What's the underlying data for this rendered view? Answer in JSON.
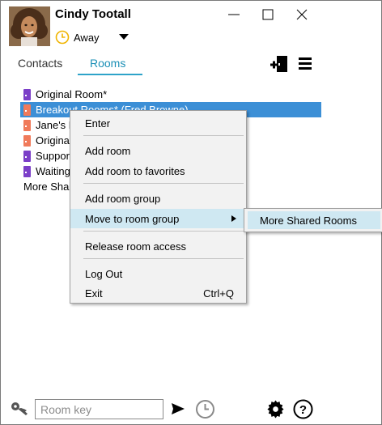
{
  "user": {
    "name": "Cindy Tootall",
    "status": "Away"
  },
  "tabs": [
    {
      "label": "Contacts",
      "active": false
    },
    {
      "label": "Rooms",
      "active": true
    }
  ],
  "rooms": [
    {
      "label": "Original Room*",
      "color": "#7b3fc8"
    },
    {
      "label": "Breakout Rooms* (Fred Browne)",
      "color": "#f07a5a",
      "selected": true
    },
    {
      "label": "Jane's M",
      "color": "#f07a5a"
    },
    {
      "label": "Origina",
      "color": "#f07a5a"
    },
    {
      "label": "Suppor",
      "color": "#7b3fc8"
    },
    {
      "label": "Waiting",
      "color": "#7b3fc8"
    }
  ],
  "groups": [
    {
      "label": "More Shar"
    }
  ],
  "context_menu": {
    "enter": "Enter",
    "add_room": "Add room",
    "add_room_favorites": "Add room to favorites",
    "add_room_group": "Add room group",
    "move_to_room_group": "Move to room group",
    "release_room_access": "Release room access",
    "log_out": "Log Out",
    "exit": "Exit",
    "exit_shortcut": "Ctrl+Q"
  },
  "submenu": {
    "item": "More Shared Rooms"
  },
  "bottom": {
    "room_key_placeholder": "Room key"
  },
  "colors": {
    "accent": "#2ea3c9",
    "selection": "#3c8fd6",
    "menu_highlight": "#cfe8f2",
    "away": "#f0b400"
  }
}
